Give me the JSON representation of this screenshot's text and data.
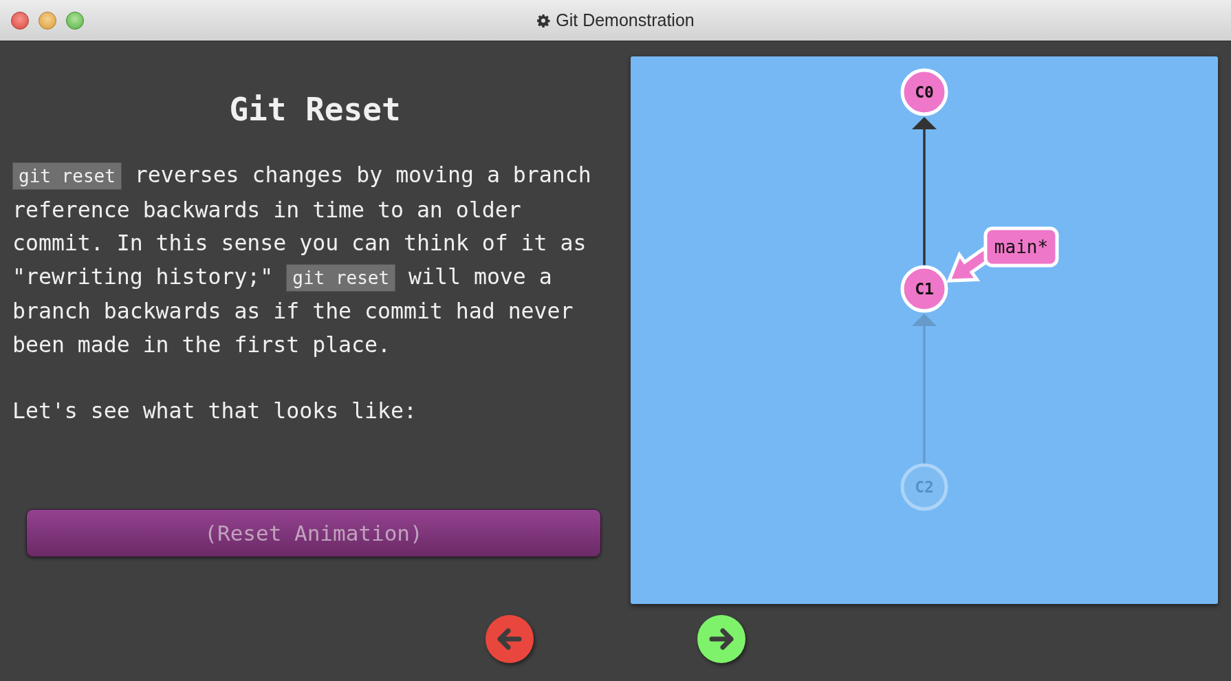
{
  "window": {
    "title": "Git Demonstration"
  },
  "heading": "Git Reset",
  "paragraphs": [
    [
      {
        "kind": "code",
        "text": "git reset"
      },
      {
        "kind": "text",
        "text": " reverses changes by moving a branch reference backwards in time to an older commit. In this sense you can think of it as \"rewriting history;\" "
      },
      {
        "kind": "code",
        "text": "git reset"
      },
      {
        "kind": "text",
        "text": " will move a branch backwards as if the commit had never been made in the first place."
      }
    ],
    [
      {
        "kind": "text",
        "text": "Let's see what that looks like:"
      }
    ]
  ],
  "reset_button": "(Reset Animation)",
  "graph": {
    "nodes": [
      {
        "label": "C0",
        "faded": false
      },
      {
        "label": "C1",
        "faded": false,
        "branch": "main*"
      },
      {
        "label": "C2",
        "faded": true
      }
    ]
  },
  "nav": [
    {
      "kind": "back"
    },
    {
      "kind": "forward"
    }
  ]
}
